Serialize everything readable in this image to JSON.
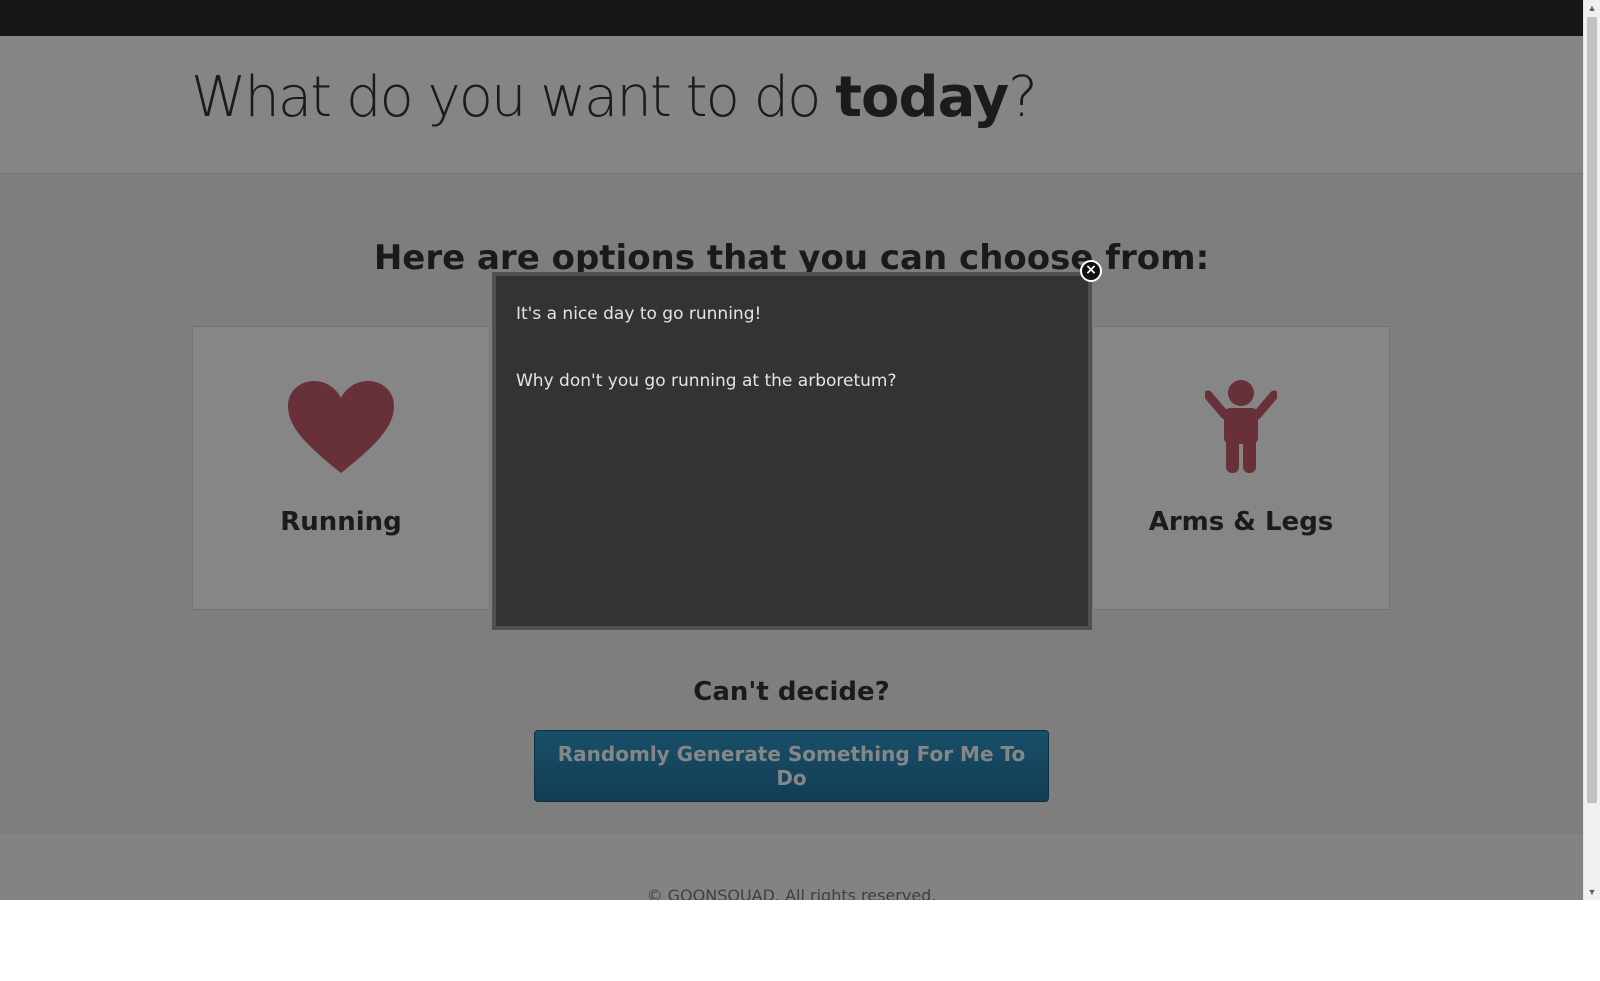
{
  "header": {
    "title_prefix": "What do you want to do ",
    "title_bold": "today",
    "title_suffix": "?"
  },
  "main": {
    "options_heading": "Here are options that you can choose from:",
    "cards": [
      {
        "label": "Running",
        "icon": "heart-icon"
      },
      {
        "label": "Arms & Legs",
        "icon": "person-icon"
      }
    ],
    "cant_decide": "Can't decide?",
    "random_button_label": "Randomly Generate Something For Me To Do"
  },
  "modal": {
    "line1": "It's a nice day to go running!",
    "line2": "Why don't you go running at the arboretum?",
    "close_glyph": "×"
  },
  "footer": {
    "text": "© GOONSQUAD. All rights reserved."
  },
  "colors": {
    "topbar": "#2b2b2b",
    "icon": "#c05a68",
    "button": "#2a82b0",
    "modal_bg": "#333333"
  }
}
